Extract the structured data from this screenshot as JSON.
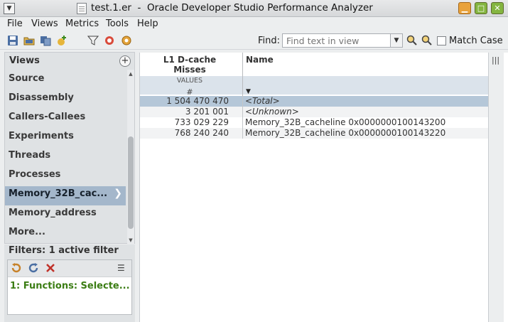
{
  "window": {
    "title": "test.1.er  -  Oracle Developer Studio Performance Analyzer",
    "menu_glyph": "▼",
    "minimize_glyph": "▁",
    "maximize_glyph": "□",
    "close_glyph": "✕"
  },
  "menubar": {
    "file": "File",
    "views": "Views",
    "metrics": "Metrics",
    "tools": "Tools",
    "help": "Help"
  },
  "toolbar": {
    "find_label": "Find:",
    "find_placeholder": "Find text in view",
    "match_case_label": "Match Case"
  },
  "views": {
    "heading": "Views",
    "add_glyph": "+",
    "items": [
      {
        "label": "Source"
      },
      {
        "label": "Disassembly"
      },
      {
        "label": "Callers-Callees"
      },
      {
        "label": "Experiments"
      },
      {
        "label": "Threads"
      },
      {
        "label": "Processes"
      },
      {
        "label": "Memory_32B_cac...",
        "selected": true
      },
      {
        "label": "Memory_address"
      },
      {
        "label": "More..."
      }
    ],
    "selected_arrow": "❯"
  },
  "filters": {
    "heading": "Filters: 1 active filter",
    "entries": [
      "1: Functions: Selecte..."
    ]
  },
  "table": {
    "metric_header_line1": "L1 D-cache",
    "metric_header_line2": "Misses",
    "metric_subheader": "VALUES",
    "metric_unit": "#",
    "name_header": "Name",
    "sort_glyph": "▼",
    "rows": [
      {
        "value": "1 504 470 470",
        "name": "<Total>",
        "italic": true,
        "selected": true
      },
      {
        "value": "3 201 001",
        "name": "<Unknown>",
        "italic": true
      },
      {
        "value": "733 029 229",
        "name": "Memory_32B_cacheline 0x0000000100143200"
      },
      {
        "value": "768 240 240",
        "name": "Memory_32B_cacheline 0x0000000100143220"
      }
    ]
  },
  "colors": {
    "selected_view": "#a4b7cb",
    "selected_row": "#b5c7d8",
    "filter_text": "#3b7d14",
    "header_band": "#dbe3eb"
  }
}
